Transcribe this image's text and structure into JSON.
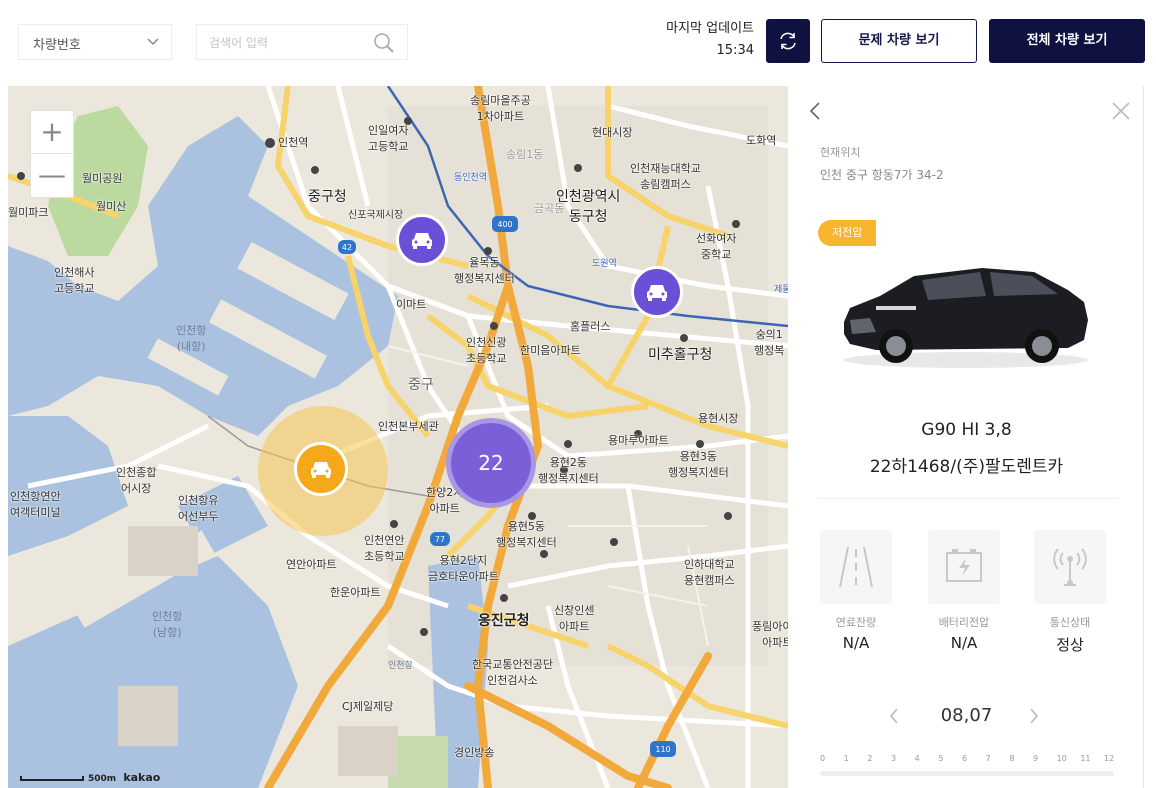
{
  "toolbar": {
    "vehicle_select": "차량번호",
    "search_placeholder": "검색어 입력",
    "last_update_label": "마지막 업데이트",
    "last_update_time": "15:34",
    "problem_button": "문제 차량 보기",
    "all_button": "전체 차량 보기"
  },
  "colors": {
    "navy": "#0f1240",
    "vehicle_marker": "#6b4fd6",
    "selected_marker": "#f5a81a",
    "badge": "#f7b62d"
  },
  "map": {
    "zoom_in": "+",
    "zoom_out": "—",
    "scale_label": "500m",
    "provider": "kakao",
    "cluster_count": "22",
    "labels": {
      "l1": "인천역",
      "l2": "인일여자\n고등학교",
      "l3": "중구청",
      "l4": "신포국제시장",
      "l5": "인천광역시\n동구청",
      "l6": "인천재능대학교\n송림캠퍼스",
      "l7": "선화여자\n중학교",
      "l8": "월미공원",
      "l9": "월미산",
      "l10": "인천해사\n고등학교",
      "l11": "인천항\n(내항)",
      "l12": "이마트",
      "l13": "율목동\n행정복지센터",
      "l14": "홈플러스",
      "l15": "미추홀구청",
      "l16": "인천신광\n초등학교",
      "l17": "한미음아파트",
      "l18": "중구",
      "l19": "인천본부세관",
      "l20": "용현시장",
      "l21": "용마루아파트",
      "l22": "인천종합\n어시장",
      "l23": "인천항연안\n여객터미널",
      "l24": "인천항유\n어선부두",
      "l25": "용현2동\n행정복지센터",
      "l26": "용현3동\n행정복지센터",
      "l27": "한양2차\n아파트",
      "l28": "용현5동\n행정복지센터",
      "l29": "연안아파트",
      "l30": "인천연안\n초등학교",
      "l31": "용현2단지\n금호타운아파트",
      "l32": "한운아파트",
      "l33": "옹진군청",
      "l34": "신창인센\n아파트",
      "l35": "인천항\n(남항)",
      "l36": "한국교통안전공단\n인천검사소",
      "l37": "CJ제일제당",
      "l38": "경인방송",
      "l39": "인하대학교\n용현캠퍼스",
      "l40": "현대시장",
      "l41": "도화역",
      "l42": "송림1동",
      "l43": "금곡동",
      "l44": "동인천역",
      "l45": "도원역",
      "l46": "제물포",
      "l47": "숭의1\n행정복",
      "l48": "인천항",
      "l49": "월미파크",
      "l50": "풍림아이원\n아파트",
      "l51": "송림마을주공\n1차아파트"
    },
    "road_shields": [
      "42",
      "400",
      "77",
      "110"
    ]
  },
  "panel": {
    "location_label": "현재위치",
    "location_value": "인천 중구 항동7가 34-2",
    "status_badge": "저전압",
    "model": "G90 HI 3,8",
    "plate": "22하1468/(주)팔도렌트카",
    "stats": [
      {
        "label": "연료잔량",
        "value": "N/A"
      },
      {
        "label": "배터리전압",
        "value": "N/A"
      },
      {
        "label": "통신상태",
        "value": "정상"
      }
    ],
    "date": "08,07",
    "hours": [
      "0",
      "1",
      "2",
      "3",
      "4",
      "5",
      "6",
      "7",
      "8",
      "9",
      "10",
      "11",
      "12"
    ]
  }
}
